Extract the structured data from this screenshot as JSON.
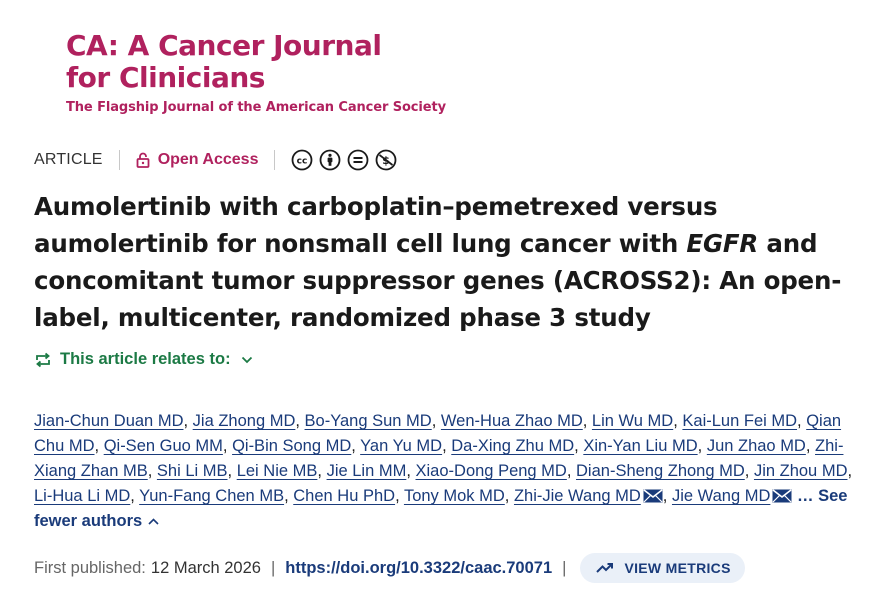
{
  "journal": {
    "name_line1": "CA: A Cancer Journal",
    "name_line2": "for Clinicians",
    "tagline": "The Flagship Journal of the American Cancer Society",
    "brand_color": "#b0215e"
  },
  "article_meta": {
    "type": "ARTICLE",
    "open_access_label": "Open Access",
    "license_icons": [
      "cc-icon",
      "by-icon",
      "nd-icon",
      "nc-icon"
    ]
  },
  "title": {
    "part1": "Aumolertinib with carboplatin–pemetrexed versus aumolertinib for nonsmall cell lung cancer with ",
    "italic": "EGFR",
    "part2": " and concomitant tumor suppressor genes (ACROSS2): An open-label, multicenter, randomized phase 3 study"
  },
  "relates": {
    "label": "This article relates to:",
    "color": "#1c7a45"
  },
  "authors": [
    {
      "name": "Jian-Chun Duan MD"
    },
    {
      "name": "Jia Zhong MD"
    },
    {
      "name": "Bo-Yang Sun MD"
    },
    {
      "name": "Wen-Hua Zhao MD"
    },
    {
      "name": "Lin Wu MD"
    },
    {
      "name": "Kai-Lun Fei MD"
    },
    {
      "name": "Qian Chu MD"
    },
    {
      "name": "Qi-Sen Guo MM"
    },
    {
      "name": "Qi-Bin Song MD"
    },
    {
      "name": "Yan Yu MD"
    },
    {
      "name": "Da-Xing Zhu MD"
    },
    {
      "name": "Xin-Yan Liu MD"
    },
    {
      "name": "Jun Zhao MD"
    },
    {
      "name": "Zhi-Xiang Zhan MB"
    },
    {
      "name": "Shi Li MB"
    },
    {
      "name": "Lei Nie MB"
    },
    {
      "name": "Jie Lin MM"
    },
    {
      "name": "Xiao-Dong Peng MD"
    },
    {
      "name": "Dian-Sheng Zhong MD"
    },
    {
      "name": "Jin Zhou MD"
    },
    {
      "name": "Li-Hua Li MD"
    },
    {
      "name": "Yun-Fang Chen MB"
    },
    {
      "name": "Chen Hu PhD"
    },
    {
      "name": "Tony Mok MD"
    },
    {
      "name": "Zhi-Jie Wang MD",
      "corresponding": true
    },
    {
      "name": "Jie Wang MD",
      "corresponding": true
    }
  ],
  "authors_toggle": "See fewer authors",
  "authors_ellipsis": "…",
  "publication": {
    "first_published_label": "First published:",
    "date": "12 March 2026",
    "separator": "|",
    "doi": "https://doi.org/10.3322/caac.70071",
    "metrics_label": "VIEW METRICS"
  }
}
